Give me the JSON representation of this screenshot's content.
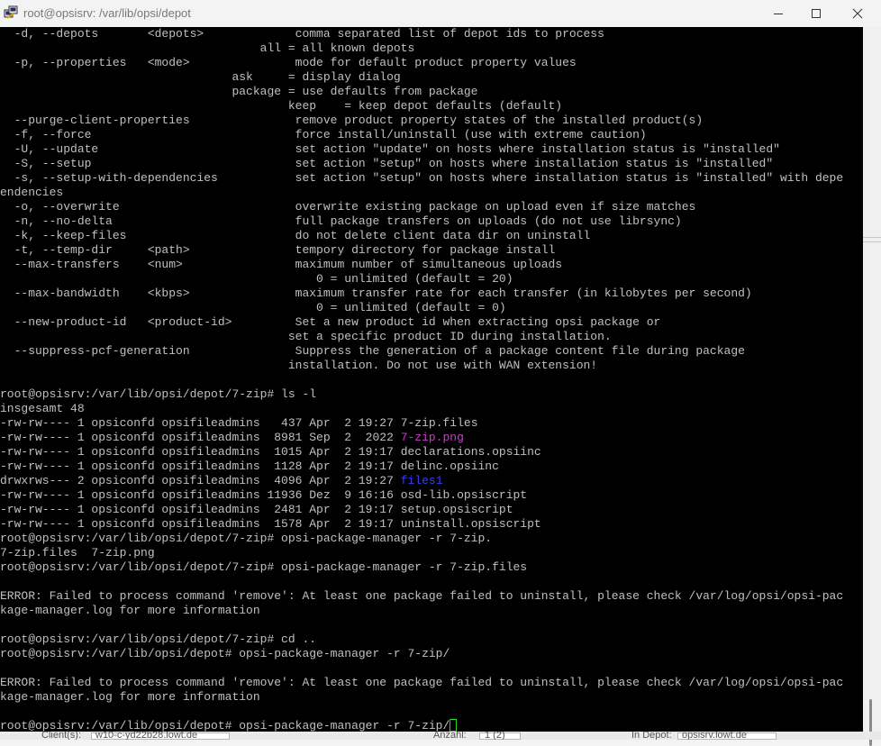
{
  "window": {
    "title": "root@opsisrv: /var/lib/opsi/depot",
    "minimize_icon": "minimize-icon",
    "maximize_icon": "maximize-icon",
    "close_icon": "close-icon",
    "app_icon": "putty-icon"
  },
  "terminal": {
    "colors": {
      "background": "#000000",
      "text": "#c0c0c0",
      "directory": "#3d3df5",
      "image_file": "#c53fc5",
      "cursor": "#1ed71e"
    },
    "lines": [
      {
        "t": "  -d, --depots       <depots>             comma separated list of depot ids to process"
      },
      {
        "t": "                                     all = all known depots"
      },
      {
        "t": "  -p, --properties   <mode>               mode for default product property values"
      },
      {
        "t": "                                 ask     = display dialog"
      },
      {
        "t": "                                 package = use defaults from package"
      },
      {
        "t": "                                         keep    = keep depot defaults (default)"
      },
      {
        "t": "  --purge-client-properties               remove product property states of the installed product(s)"
      },
      {
        "t": "  -f, --force                             force install/uninstall (use with extreme caution)"
      },
      {
        "t": "  -U, --update                            set action \"update\" on hosts where installation status is \"installed\""
      },
      {
        "t": "  -S, --setup                             set action \"setup\" on hosts where installation status is \"installed\""
      },
      {
        "t": "  -s, --setup-with-dependencies           set action \"setup\" on hosts where installation status is \"installed\" with depe"
      },
      {
        "t": "endencies"
      },
      {
        "t": "  -o, --overwrite                         overwrite existing package on upload even if size matches"
      },
      {
        "t": "  -n, --no-delta                          full package transfers on uploads (do not use librsync)"
      },
      {
        "t": "  -k, --keep-files                        do not delete client data dir on uninstall"
      },
      {
        "t": "  -t, --temp-dir     <path>               tempory directory for package install"
      },
      {
        "t": "  --max-transfers    <num>                maximum number of simultaneous uploads"
      },
      {
        "t": "                                             0 = unlimited (default = 20)"
      },
      {
        "t": "  --max-bandwidth    <kbps>               maximum transfer rate for each transfer (in kilobytes per second)"
      },
      {
        "t": "                                             0 = unlimited (default = 0)"
      },
      {
        "t": "  --new-product-id   <product-id>         Set a new product id when extracting opsi package or"
      },
      {
        "t": "                                         set a specific product ID during installation."
      },
      {
        "t": "  --suppress-pcf-generation               Suppress the generation of a package content file during package"
      },
      {
        "t": "                                         installation. Do not use with WAN extension!"
      },
      {
        "t": ""
      },
      {
        "t": "root@opsisrv:/var/lib/opsi/depot/7-zip# ls -l"
      },
      {
        "t": "insgesamt 48"
      },
      {
        "t": "-rw-rw---- 1 opsiconfd opsifileadmins   437 Apr  2 19:27 ",
        "n": "7-zip.files"
      },
      {
        "t": "-rw-rw---- 1 opsiconfd opsifileadmins  8981 Sep  2  2022 ",
        "n": "7-zip.png",
        "c": "img"
      },
      {
        "t": "-rw-rw---- 1 opsiconfd opsifileadmins  1015 Apr  2 19:17 ",
        "n": "declarations.opsiinc"
      },
      {
        "t": "-rw-rw---- 1 opsiconfd opsifileadmins  1128 Apr  2 19:17 ",
        "n": "delinc.opsiinc"
      },
      {
        "t": "drwxrws--- 2 opsiconfd opsifileadmins  4096 Apr  2 19:27 ",
        "n": "files1",
        "c": "dir"
      },
      {
        "t": "-rw-rw---- 1 opsiconfd opsifileadmins 11936 Dez  9 16:16 ",
        "n": "osd-lib.opsiscript"
      },
      {
        "t": "-rw-rw---- 1 opsiconfd opsifileadmins  2481 Apr  2 19:17 ",
        "n": "setup.opsiscript"
      },
      {
        "t": "-rw-rw---- 1 opsiconfd opsifileadmins  1578 Apr  2 19:17 ",
        "n": "uninstall.opsiscript"
      },
      {
        "t": "root@opsisrv:/var/lib/opsi/depot/7-zip# opsi-package-manager -r 7-zip."
      },
      {
        "t": "7-zip.files  7-zip.png"
      },
      {
        "t": "root@opsisrv:/var/lib/opsi/depot/7-zip# opsi-package-manager -r 7-zip.files"
      },
      {
        "t": ""
      },
      {
        "t": "ERROR: Failed to process command 'remove': At least one package failed to uninstall, please check /var/log/opsi/opsi-pac"
      },
      {
        "t": "kage-manager.log for more information"
      },
      {
        "t": ""
      },
      {
        "t": "root@opsisrv:/var/lib/opsi/depot/7-zip# cd .."
      },
      {
        "t": "root@opsisrv:/var/lib/opsi/depot# opsi-package-manager -r 7-zip/"
      },
      {
        "t": ""
      },
      {
        "t": "ERROR: Failed to process command 'remove': At least one package failed to uninstall, please check /var/log/opsi/opsi-pac"
      },
      {
        "t": "kage-manager.log for more information"
      },
      {
        "t": ""
      },
      {
        "t": "root@opsisrv:/var/lib/opsi/depot# opsi-package-manager -r 7-zip/",
        "cursor": true
      }
    ]
  },
  "underlay": {
    "clients_label": "Client(s):",
    "clients_value": "w10-c-yd22b28.lowt.de",
    "anzahl_label": "Anzahl:",
    "anzahl_value": "1 (2)",
    "depot_label": "In Depot:",
    "depot_value": "opsisrv.lowt.de"
  }
}
